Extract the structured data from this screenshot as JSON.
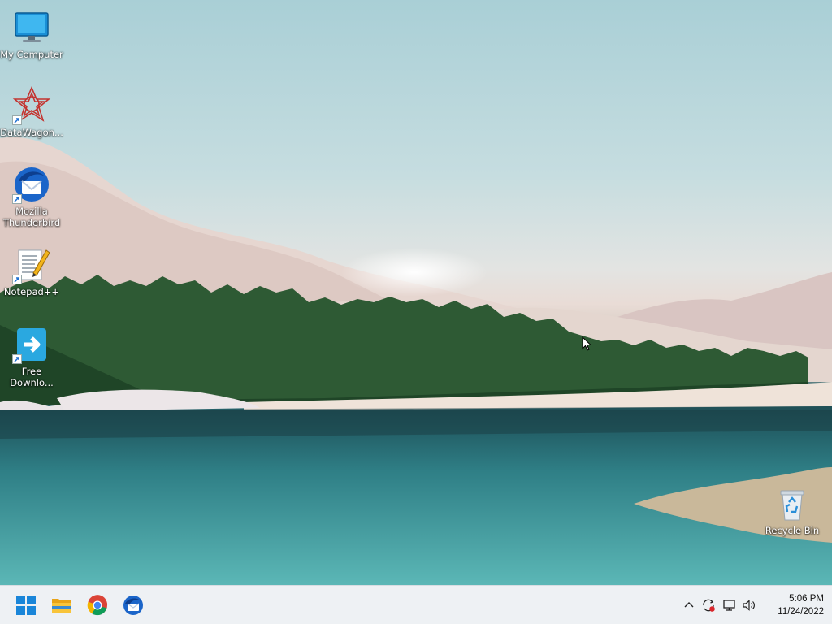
{
  "desktop": {
    "icons": [
      {
        "label": "My Computer",
        "icon": "monitor-icon"
      },
      {
        "label": "DataWagon...",
        "icon": "datawagon-icon"
      },
      {
        "label": "Mozilla\nThunderbird",
        "icon": "thunderbird-icon"
      },
      {
        "label": "Notepad++",
        "icon": "notepad-icon"
      },
      {
        "label": "Free\nDownlo...",
        "icon": "free-download-manager-icon"
      },
      {
        "label": "Recycle Bin",
        "icon": "recycle-bin-icon"
      }
    ]
  },
  "taskbar": {
    "pinned": [
      "windows-start-icon",
      "file-explorer-icon",
      "chrome-icon",
      "thunderbird-icon"
    ],
    "tray": [
      "chevron-up-icon",
      "sync-alert-icon",
      "network-icon",
      "volume-icon"
    ],
    "clock": {
      "time": "5:06 PM",
      "date": "11/24/2022"
    }
  },
  "colors": {
    "taskbar": "#eef1f4",
    "accent": "#0067c0"
  }
}
